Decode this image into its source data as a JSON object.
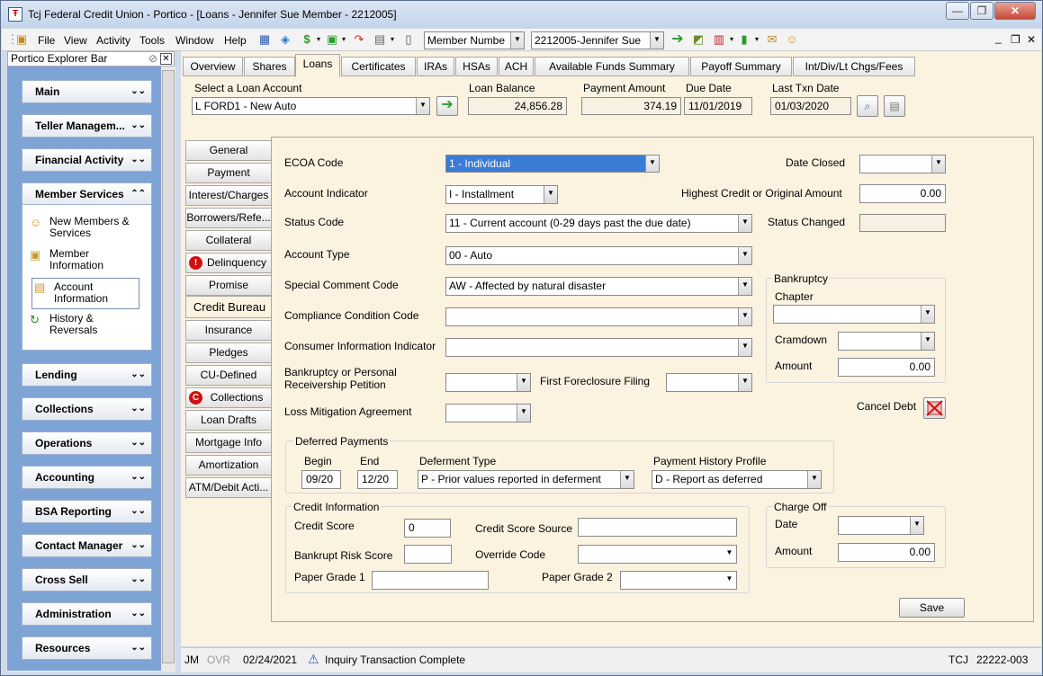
{
  "window": {
    "title": "Tcj Federal Credit Union - Portico - [Loans - Jennifer Sue Member - 2212005]",
    "min": "—",
    "max": "❐",
    "close": "✕"
  },
  "menu": [
    "File",
    "View",
    "Activity",
    "Tools",
    "Window",
    "Help"
  ],
  "toolbar": {
    "search_type": "Member Numbe",
    "member": "2212005-Jennifer Sue",
    "mdi_min": "_",
    "mdi_restore": "❐",
    "mdi_close": "✕"
  },
  "sidebar": {
    "title": "Portico Explorer Bar",
    "nav_top": [
      {
        "label": "Main"
      },
      {
        "label": "Teller Managem..."
      },
      {
        "label": "Financial Activity"
      },
      {
        "label": "Member Services"
      }
    ],
    "sub_items": [
      {
        "label": "New Members & Services",
        "icon": "people-icon"
      },
      {
        "label": "Member Information",
        "icon": "person-card-icon"
      },
      {
        "label": "Account Information",
        "icon": "account-icon"
      },
      {
        "label": "History & Reversals",
        "icon": "history-icon"
      }
    ],
    "nav_bottom": [
      {
        "label": "Lending"
      },
      {
        "label": "Collections"
      },
      {
        "label": "Operations"
      },
      {
        "label": "Accounting"
      },
      {
        "label": "BSA Reporting"
      },
      {
        "label": "Contact Manager"
      },
      {
        "label": "Cross Sell"
      },
      {
        "label": "Administration"
      },
      {
        "label": "Resources"
      }
    ]
  },
  "tabs": [
    "Overview",
    "Shares",
    "Loans",
    "Certificates",
    "IRAs",
    "HSAs",
    "ACH",
    "Available Funds Summary",
    "Payoff Summary",
    "Int/Div/Lt Chgs/Fees"
  ],
  "header": {
    "select_label": "Select a Loan Account",
    "select_value": "L   FORD1 - New Auto",
    "balance_label": "Loan Balance",
    "balance": "24,856.28",
    "payment_label": "Payment Amount",
    "payment": "374.19",
    "due_label": "Due Date",
    "due": "11/01/2019",
    "last_label": "Last Txn Date",
    "last": "01/03/2020"
  },
  "side_tabs": [
    "General",
    "Payment",
    "Interest/Charges",
    "Borrowers/Refe...",
    "Collateral",
    "Delinquency",
    "Promise",
    "Credit Bureau",
    "Insurance",
    "Pledges",
    "CU-Defined",
    "Collections",
    "Loan Drafts",
    "Mortgage Info",
    "Amortization",
    "ATM/Debit Acti..."
  ],
  "form": {
    "ecoa_label": "ECOA Code",
    "ecoa": "1 - Individual",
    "acct_ind_label": "Account Indicator",
    "acct_ind": "I - Installment",
    "status_label": "Status Code",
    "status": "11 - Current account (0-29 days past the due date)",
    "type_label": "Account Type",
    "type": "00 - Auto",
    "special_label": "Special Comment Code",
    "special": "AW - Affected by natural disaster",
    "compliance_label": "Compliance Condition Code",
    "compliance": "",
    "consumer_label": "Consumer Information Indicator",
    "consumer": "",
    "bk_petition_label": "Bankruptcy or Personal Receivership Petition",
    "bk_petition": "",
    "foreclosure_label": "First Foreclosure Filing",
    "foreclosure": "",
    "loss_label": "Loss Mitigation Agreement",
    "loss": "",
    "date_closed_label": "Date Closed",
    "date_closed": "",
    "highest_label": "Highest Credit or Original Amount",
    "highest": "0.00",
    "status_changed_label": "Status Changed",
    "status_changed": "",
    "bankruptcy_title": "Bankruptcy",
    "chapter_label": "Chapter",
    "chapter": "",
    "cramdown_label": "Cramdown",
    "cramdown": "",
    "bk_amount_label": "Amount",
    "bk_amount": "0.00",
    "cancel_label": "Cancel Debt",
    "deferred_title": "Deferred Payments",
    "begin_label": "Begin",
    "begin": "09/20",
    "end_label": "End",
    "end": "12/20",
    "def_type_label": "Deferment Type",
    "def_type": "P - Prior values reported in deferment",
    "profile_label": "Payment History Profile",
    "profile": "D - Report as deferred",
    "credit_title": "Credit Information",
    "score_label": "Credit Score",
    "score": "0",
    "source_label": "Credit Score Source",
    "source": "",
    "bk_risk_label": "Bankrupt Risk Score",
    "bk_risk": "",
    "override_label": "Override Code",
    "override": "",
    "pg1_label": "Paper Grade 1",
    "pg1": "",
    "pg2_label": "Paper Grade 2",
    "pg2": "",
    "chargeoff_title": "Charge Off",
    "co_date_label": "Date",
    "co_date": "",
    "co_amount_label": "Amount",
    "co_amount": "0.00",
    "save": "Save"
  },
  "status": {
    "user": "JM",
    "ovr": "OVR",
    "date": "02/24/2021",
    "message": "Inquiry Transaction Complete",
    "inst": "TCJ",
    "code": "22222-003"
  }
}
